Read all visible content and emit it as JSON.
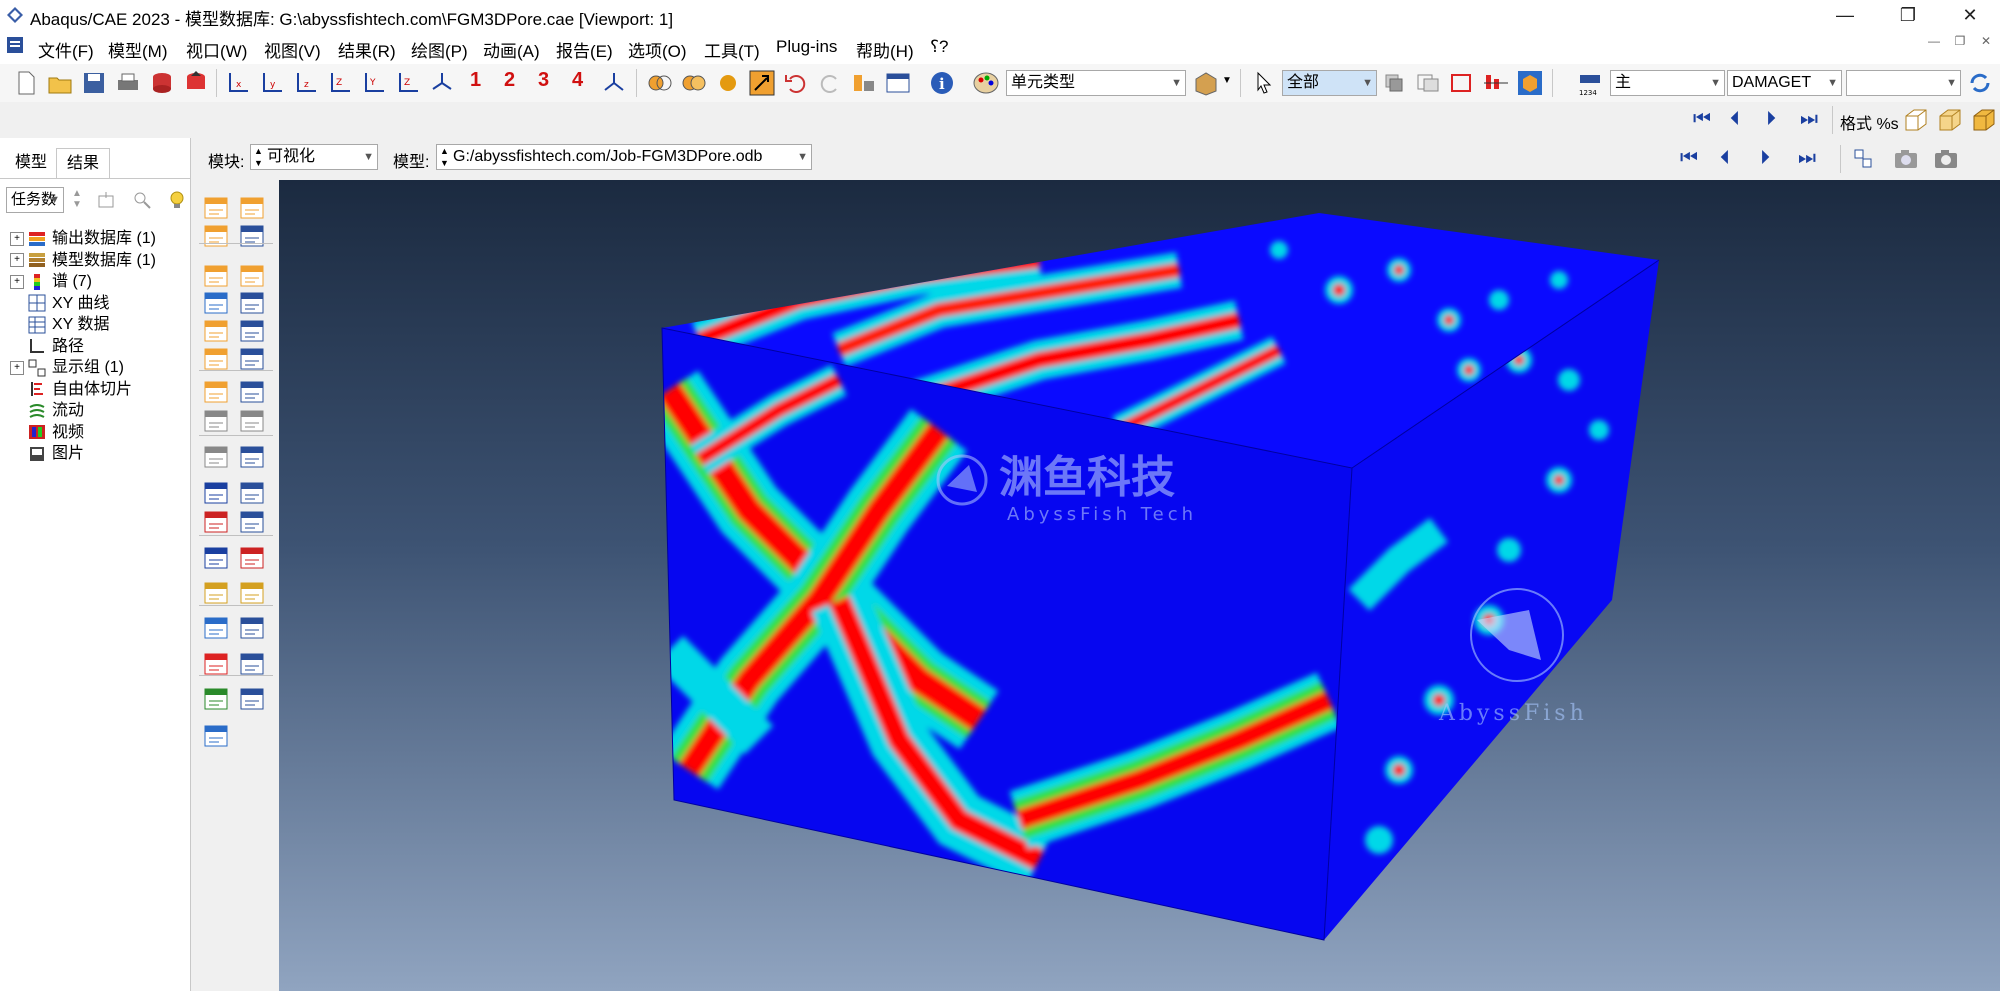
{
  "window": {
    "title": "Abaqus/CAE 2023 - 模型数据库: G:\\abyssfishtech.com\\FGM3DPore.cae [Viewport: 1]",
    "controls": {
      "minimize": "—",
      "restore": "❐",
      "close": "✕"
    }
  },
  "menu": {
    "items": [
      "文件(F)",
      "模型(M)",
      "视口(W)",
      "视图(V)",
      "结果(R)",
      "绘图(P)",
      "动画(A)",
      "报告(E)",
      "选项(O)",
      "工具(T)",
      "Plug-ins",
      "帮助(H)",
      "⸮?"
    ]
  },
  "toolbar": {
    "numbers": [
      "1",
      "2",
      "3",
      "4"
    ],
    "element_type_combo": "单元类型",
    "selection_combo": "全部",
    "step_combo": "主",
    "variable_combo": "DAMAGET",
    "extra_combo": "",
    "format_label": "格式 %s"
  },
  "context": {
    "module_label": "模块:",
    "module_value": "可视化",
    "model_label": "模型:",
    "model_value": "G:/abyssfishtech.com/Job-FGM3DPore.odb"
  },
  "left_panel": {
    "tabs": [
      "模型",
      "结果"
    ],
    "active_tab": "结果",
    "filter_combo": "任务数",
    "tree": [
      {
        "label": "输出数据库 (1)",
        "expandable": true,
        "icon": "odb-icon"
      },
      {
        "label": "模型数据库 (1)",
        "expandable": true,
        "icon": "mdb-icon"
      },
      {
        "label": "谱 (7)",
        "expandable": true,
        "icon": "spectrum-icon"
      },
      {
        "label": "XY 曲线",
        "expandable": false,
        "icon": "xy-plot-icon"
      },
      {
        "label": "XY 数据",
        "expandable": false,
        "icon": "xy-data-icon"
      },
      {
        "label": "路径",
        "expandable": false,
        "icon": "path-icon"
      },
      {
        "label": "显示组 (1)",
        "expandable": true,
        "icon": "display-group-icon"
      },
      {
        "label": "自由体切片",
        "expandable": false,
        "icon": "free-body-icon"
      },
      {
        "label": "流动",
        "expandable": false,
        "icon": "stream-icon"
      },
      {
        "label": "视频",
        "expandable": false,
        "icon": "movie-icon"
      },
      {
        "label": "图片",
        "expandable": false,
        "icon": "image-icon"
      }
    ]
  },
  "viewport": {
    "watermark_cn": "渊鱼科技",
    "watermark_en": "AbyssFish Tech",
    "logo_text": "AbyssFish",
    "colors": {
      "low": "#0000ff",
      "mid": "#00e0e0",
      "midhigh": "#20d020",
      "high": "#ff0000",
      "bg_top": "#1b2a40",
      "bg_bottom": "#90a4c0"
    }
  }
}
